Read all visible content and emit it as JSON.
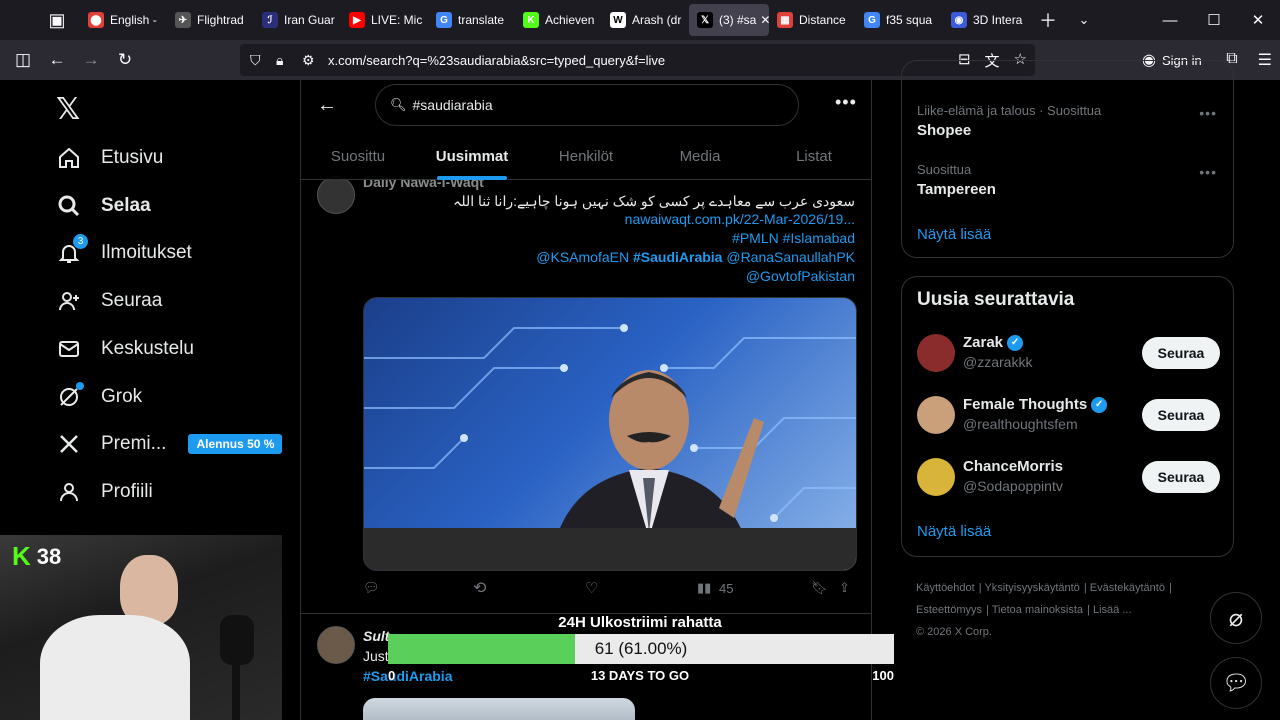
{
  "browser": {
    "tabs": [
      {
        "label": "English -",
        "fav_color": "#e0403a",
        "fav_glyph": "⬤"
      },
      {
        "label": "Flightrad",
        "fav_color": "#555555",
        "fav_glyph": "✈"
      },
      {
        "label": "Iran Guar",
        "fav_color": "#2a2f7a",
        "fav_glyph": "ℐ"
      },
      {
        "label": "LIVE: Mic",
        "fav_color": "#ff0000",
        "fav_glyph": "▶"
      },
      {
        "label": "translate",
        "fav_color": "#4285f4",
        "fav_glyph": "G"
      },
      {
        "label": "Achieven",
        "fav_color": "#53fc18",
        "fav_glyph": "K"
      },
      {
        "label": "Arash (dr",
        "fav_color": "#ffffff",
        "fav_glyph": "W"
      },
      {
        "label": "(3) #sa",
        "fav_color": "#000000",
        "fav_glyph": "𝕏"
      },
      {
        "label": "Distance",
        "fav_color": "#e0403a",
        "fav_glyph": "▦"
      },
      {
        "label": "f35 squa",
        "fav_color": "#4285f4",
        "fav_glyph": "G"
      },
      {
        "label": "3D Intera",
        "fav_color": "#3b5bdb",
        "fav_glyph": "◉"
      }
    ],
    "active_tab": 7,
    "url": "x.com/search?q=%23saudiarabia&src=typed_query&f=live",
    "signin_label": "Sign in"
  },
  "nav": {
    "items": [
      {
        "label": "Etusivu",
        "icon": "home-icon"
      },
      {
        "label": "Selaa",
        "icon": "search-icon",
        "bold": true
      },
      {
        "label": "Ilmoitukset",
        "icon": "bell-icon",
        "badge": "3"
      },
      {
        "label": "Seuraa",
        "icon": "add-person-icon"
      },
      {
        "label": "Keskustelu",
        "icon": "mail-icon"
      },
      {
        "label": "Grok",
        "icon": "grok-icon"
      },
      {
        "label": "Premi...",
        "icon": "x-icon"
      },
      {
        "label": "Profiili",
        "icon": "person-icon"
      }
    ],
    "promo": "Alennus 50 %"
  },
  "webcam": {
    "kick_count": "38"
  },
  "search": {
    "query": "#saudiarabia",
    "tabs": [
      "Suosittu",
      "Uusimmat",
      "Henkilöt",
      "Media",
      "Listat"
    ],
    "active_tab": 1
  },
  "tweet1": {
    "author": "Daily Nawa-i-Waqt",
    "text": "سعودی عرب سے معاہدے پر کسی کو شک نہیں ہونا چاہیے:رانا ثنا اللہ",
    "link": "nawaiwaqt.com.pk/22-Mar-2026/19...",
    "hashtags_line": "#PMLN #Islamabad",
    "mentions_a": "@KSAmofaEN",
    "mentions_b": "#SaudiArabia",
    "mentions_c": "@RanaSanaullahPK",
    "mentions_d": "@GovtofPakistan",
    "views": "45"
  },
  "tweet2": {
    "author": "Sult",
    "text": "Just",
    "hashtag": "#SaudiArabia"
  },
  "right": {
    "trends": [
      {
        "context": "Liike-elämä ja talous · Suosittua",
        "name": "Shopee"
      },
      {
        "context": "Suosittua",
        "name": "Tampereen"
      }
    ],
    "show_more": "Näytä lisää",
    "who_title": "Uusia seurattavia",
    "users": [
      {
        "name": "Zarak",
        "handle": "@zzarakkk",
        "verified": true,
        "avatar_color": "#8a2c2c"
      },
      {
        "name": "Female Thoughts",
        "handle": "@realthoughtsfem",
        "verified": true,
        "avatar_color": "#c9a07a"
      },
      {
        "name": "ChanceMorris",
        "handle": "@Sodapoppintv",
        "verified": false,
        "avatar_color": "#d9b43a"
      }
    ],
    "follow_label": "Seuraa",
    "show_more_2": "Näytä lisää",
    "footer": [
      "Käyttöehdot",
      "Yksityisyyskäytäntö",
      "Evästekäytäntö",
      "Esteettömyys",
      "Tietoa mainoksista",
      "Lisää ...",
      "© 2026 X Corp."
    ]
  },
  "donation": {
    "title": "24H Ulkostriimi rahatta",
    "value": 61,
    "max": 100,
    "label": "61 (61.00%)",
    "min_label": "0",
    "max_label": "100",
    "days": "13 DAYS TO GO"
  }
}
